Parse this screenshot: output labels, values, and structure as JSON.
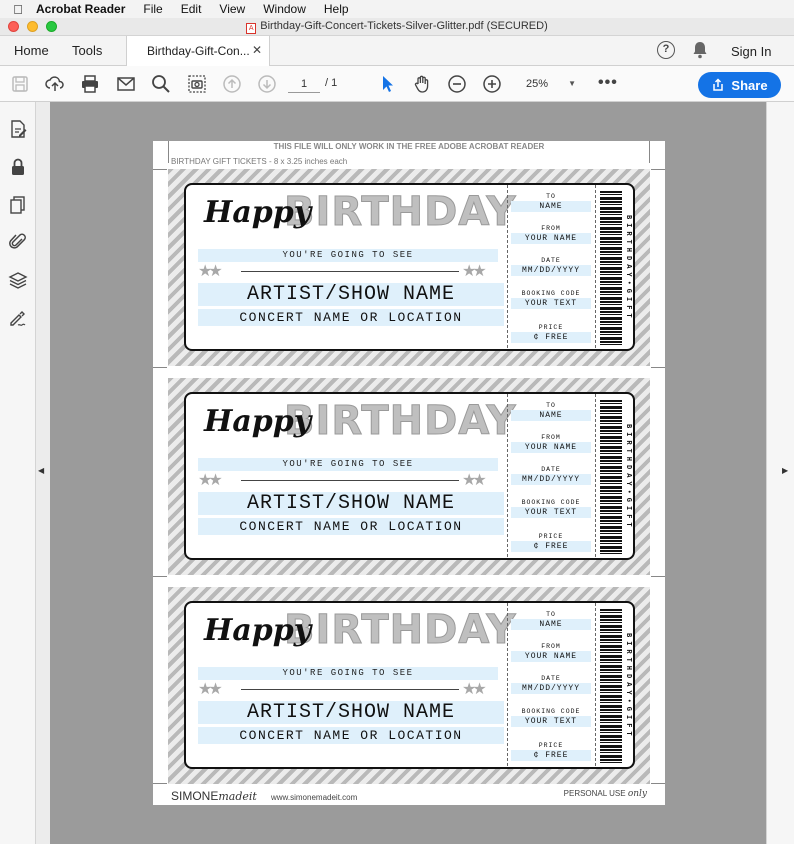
{
  "menubar": {
    "app_name": "Acrobat Reader",
    "items": [
      "File",
      "Edit",
      "View",
      "Window",
      "Help"
    ]
  },
  "window": {
    "title": "Birthday-Gift-Concert-Tickets-Silver-Glitter.pdf (SECURED)"
  },
  "tabs": {
    "home": "Home",
    "tools": "Tools",
    "document": "Birthday-Gift-Con...",
    "sign_in": "Sign In"
  },
  "toolbar": {
    "page_current": "1",
    "page_total": "/ 1",
    "zoom": "25%",
    "share_label": "Share"
  },
  "colors": {
    "accent": "#1473e6",
    "ticket_highlight": "#dff0fb",
    "canvas": "#9b9b9b"
  },
  "document": {
    "top_note": "THIS FILE WILL ONLY WORK IN THE FREE ADOBE ACROBAT READER",
    "subnote": "BIRTHDAY GIFT TICKETS - 8 x 3.25 inches each",
    "footer_brand_a": "SIMONE",
    "footer_brand_b": "madeit",
    "footer_url": "www.simonemadeit.com",
    "footer_personal_a": "PERSONAL USE ",
    "footer_personal_b": "only",
    "tickets": [
      {
        "happy": "Happy",
        "birthday": "BIRTHDAY",
        "going": "YOU'RE GOING TO SEE",
        "artist": "ARTIST/SHOW NAME",
        "venue": "CONCERT NAME OR LOCATION",
        "to_label": "TO",
        "to_value": "NAME",
        "from_label": "FROM",
        "from_value": "YOUR NAME",
        "date_label": "DATE",
        "date_value": "MM/DD/YYYY",
        "booking_label": "BOOKING CODE",
        "booking_value": "YOUR TEXT",
        "price_label": "PRICE",
        "price_value": "¢ FREE",
        "barcode_text": "BIRTHDAY•GIFT"
      },
      {
        "happy": "Happy",
        "birthday": "BIRTHDAY",
        "going": "YOU'RE GOING TO SEE",
        "artist": "ARTIST/SHOW NAME",
        "venue": "CONCERT NAME OR LOCATION",
        "to_label": "TO",
        "to_value": "NAME",
        "from_label": "FROM",
        "from_value": "YOUR NAME",
        "date_label": "DATE",
        "date_value": "MM/DD/YYYY",
        "booking_label": "BOOKING CODE",
        "booking_value": "YOUR TEXT",
        "price_label": "PRICE",
        "price_value": "¢ FREE",
        "barcode_text": "BIRTHDAY•GIFT"
      },
      {
        "happy": "Happy",
        "birthday": "BIRTHDAY",
        "going": "YOU'RE GOING TO SEE",
        "artist": "ARTIST/SHOW NAME",
        "venue": "CONCERT NAME OR LOCATION",
        "to_label": "TO",
        "to_value": "NAME",
        "from_label": "FROM",
        "from_value": "YOUR NAME",
        "date_label": "DATE",
        "date_value": "MM/DD/YYYY",
        "booking_label": "BOOKING CODE",
        "booking_value": "YOUR TEXT",
        "price_label": "PRICE",
        "price_value": "¢ FREE",
        "barcode_text": "BIRTHDAY•GIFT"
      }
    ]
  },
  "icons": {
    "toolbar": [
      "save-icon",
      "upload-icon",
      "print-icon",
      "mail-icon",
      "search-icon",
      "snapshot-icon",
      "page-up-icon",
      "page-down-icon",
      "select-cursor-icon",
      "hand-icon",
      "zoom-out-icon",
      "zoom-in-icon"
    ],
    "left_rail": [
      "edit-pdf-icon",
      "lock-icon",
      "pages-icon",
      "attachment-icon",
      "layers-icon",
      "signature-icon"
    ]
  }
}
